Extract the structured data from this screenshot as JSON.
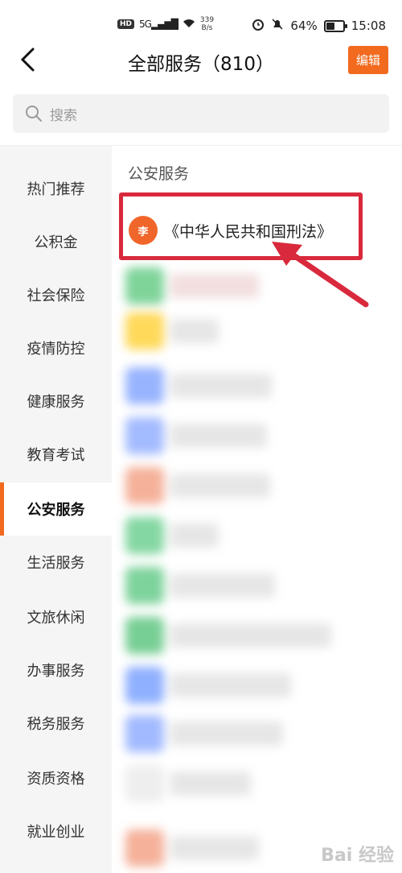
{
  "status_bar": {
    "hd": "HD",
    "signal": "5G",
    "net_speed_value": "339",
    "net_speed_unit": "B/s",
    "battery": "64%",
    "battery_level": 0.64,
    "time": "15:08"
  },
  "header": {
    "title": "全部服务（810）",
    "edit_label": "编辑"
  },
  "search": {
    "placeholder": "搜索"
  },
  "sidebar": {
    "items": [
      {
        "label": "热门推荐"
      },
      {
        "label": "公积金"
      },
      {
        "label": "社会保险"
      },
      {
        "label": "疫情防控"
      },
      {
        "label": "健康服务"
      },
      {
        "label": "教育考试"
      },
      {
        "label": "公安服务",
        "active": true
      },
      {
        "label": "生活服务"
      },
      {
        "label": "文旅休闲"
      },
      {
        "label": "办事服务"
      },
      {
        "label": "税务服务"
      },
      {
        "label": "资质资格"
      },
      {
        "label": "就业创业"
      }
    ]
  },
  "content": {
    "section_title": "公安服务",
    "highlighted_service": {
      "name": "《中华人民共和国刑法》",
      "logo_glyph": "李"
    }
  },
  "colors": {
    "accent": "#f26a1e",
    "highlight_border": "#d9293c"
  },
  "watermark": "Bai 经验"
}
